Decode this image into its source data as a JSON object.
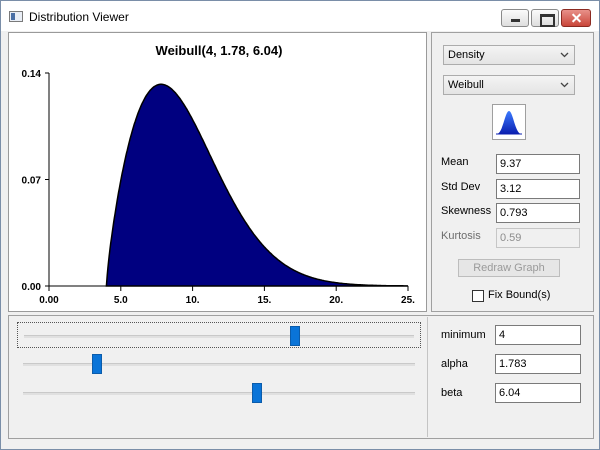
{
  "window": {
    "title": "Distribution Viewer"
  },
  "chart_data": {
    "type": "area",
    "title": "Weibull(4, 1.78, 6.04)",
    "xlabel": "",
    "ylabel": "",
    "xlim": [
      0,
      25
    ],
    "ylim": [
      0,
      0.14
    ],
    "xticks": [
      "0.00",
      "5.0",
      "10.",
      "15.",
      "20.",
      "25."
    ],
    "yticks": [
      "0.00",
      "0.07",
      "0.14"
    ],
    "grid": false,
    "fill_color": "#000080",
    "distribution": {
      "name": "Weibull",
      "minimum": 4,
      "alpha": 1.783,
      "beta": 6.04
    }
  },
  "controls": {
    "plot_type": "Density",
    "distribution": "Weibull",
    "shape_icon": "distribution-shape-icon",
    "stats": [
      {
        "label": "Mean",
        "value": "9.37",
        "enabled": true
      },
      {
        "label": "Std Dev",
        "value": "3.12",
        "enabled": true
      },
      {
        "label": "Skewness",
        "value": "0.793",
        "enabled": true
      },
      {
        "label": "Kurtosis",
        "value": "0.59",
        "enabled": false
      }
    ],
    "redraw_label": "Redraw Graph",
    "fix_bounds_label": "Fix Bound(s)",
    "fix_bounds_checked": false
  },
  "params": [
    {
      "label": "minimum",
      "value": "4",
      "slider_fraction": 0.7
    },
    {
      "label": "alpha",
      "value": "1.783",
      "slider_fraction": 0.18
    },
    {
      "label": "beta",
      "value": "6.04",
      "slider_fraction": 0.6
    }
  ],
  "colors": {
    "accent": "#0a74d8",
    "curve_fill": "#000080"
  }
}
